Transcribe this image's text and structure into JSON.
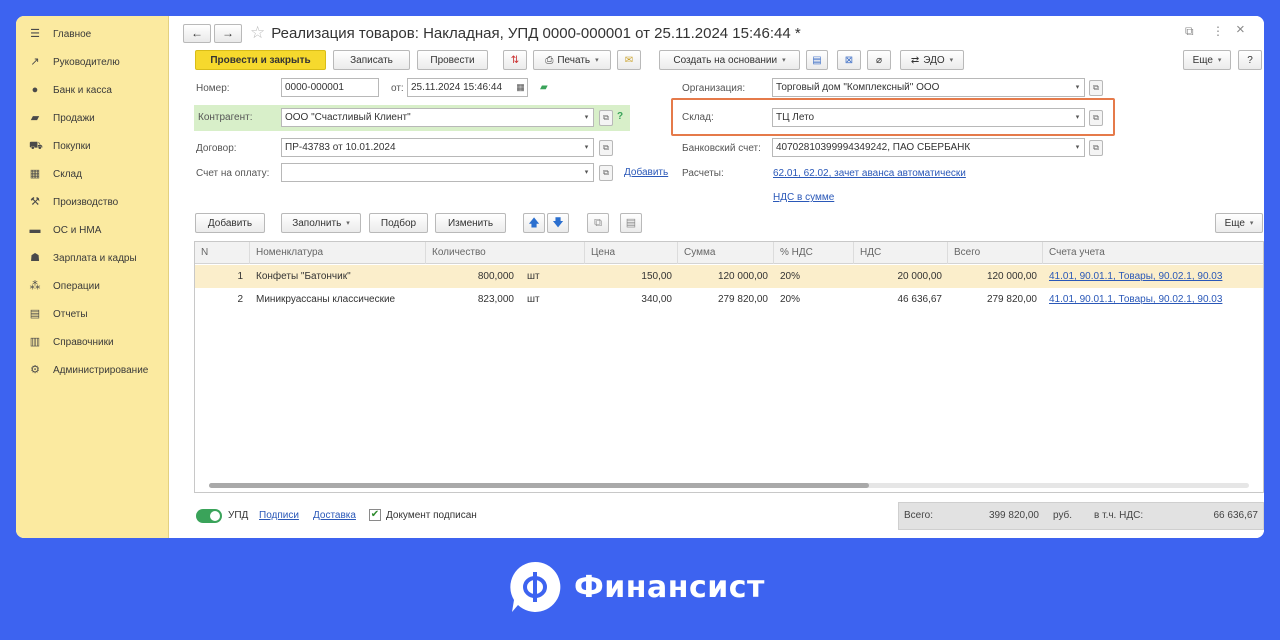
{
  "sidebar": {
    "items": [
      {
        "label": "Главное",
        "icon": "menu-icon"
      },
      {
        "label": "Руководителю",
        "icon": "chart-trend-icon"
      },
      {
        "label": "Банк и касса",
        "icon": "coins-icon"
      },
      {
        "label": "Продажи",
        "icon": "sales-icon"
      },
      {
        "label": "Покупки",
        "icon": "cart-icon"
      },
      {
        "label": "Склад",
        "icon": "warehouse-icon"
      },
      {
        "label": "Производство",
        "icon": "factory-icon"
      },
      {
        "label": "ОС и НМА",
        "icon": "truck-icon"
      },
      {
        "label": "Зарплата и кадры",
        "icon": "people-icon"
      },
      {
        "label": "Операции",
        "icon": "operations-icon"
      },
      {
        "label": "Отчеты",
        "icon": "report-icon"
      },
      {
        "label": "Справочники",
        "icon": "book-icon"
      },
      {
        "label": "Администрирование",
        "icon": "gear-icon"
      }
    ]
  },
  "header": {
    "back": "←",
    "forward": "→",
    "star": "☆",
    "title": "Реализация товаров: Накладная, УПД 0000-000001 от 25.11.2024 15:46:44 *",
    "link_icon": "🔗",
    "more": "⋮",
    "close": "×"
  },
  "toolbar": {
    "post_close": "Провести и закрыть",
    "save": "Записать",
    "post": "Провести",
    "print": "Печать",
    "create_based": "Создать на основании",
    "edo": "ЭДО",
    "more": "Еще",
    "help": "?"
  },
  "form": {
    "number_label": "Номер:",
    "number_value": "0000-000001",
    "date_label": "от:",
    "date_value": "25.11.2024 15:46:44",
    "counterparty_label": "Контрагент:",
    "counterparty_value": "ООО \"Счастливый Клиент\"",
    "counterparty_help": "?",
    "contract_label": "Договор:",
    "contract_value": "ПР-43783 от 10.01.2024",
    "invoice_label": "Счет на оплату:",
    "invoice_value": "",
    "invoice_add": "Добавить",
    "org_label": "Организация:",
    "org_value": "Торговый дом \"Комплексный\" ООО",
    "warehouse_label": "Склад:",
    "warehouse_value": "ТЦ Лето",
    "bank_label": "Банковский счет:",
    "bank_value": "40702810399994349242, ПАО СБЕРБАНК",
    "settlements_label": "Расчеты:",
    "settlements_link": "62.01, 62.02, зачет аванса автоматически",
    "vat_link": "НДС в сумме"
  },
  "table_toolbar": {
    "add": "Добавить",
    "fill": "Заполнить",
    "pick": "Подбор",
    "change": "Изменить",
    "up": "🡅",
    "down": "🡇",
    "more": "Еще"
  },
  "table": {
    "columns": [
      "N",
      "Номенклатура",
      "Количество",
      "Цена",
      "Сумма",
      "% НДС",
      "НДС",
      "Всего",
      "Счета учета"
    ],
    "rows": [
      {
        "n": "1",
        "name": "Конфеты \"Батончик\"",
        "qty": "800,000",
        "unit": "шт",
        "price": "150,00",
        "sum": "120 000,00",
        "vat_rate": "20%",
        "vat": "20 000,00",
        "total": "120 000,00",
        "accounts": "41.01, 90.01.1, Товары, 90.02.1, 90.03"
      },
      {
        "n": "2",
        "name": "Миникруассаны классические",
        "qty": "823,000",
        "unit": "шт",
        "price": "340,00",
        "sum": "279 820,00",
        "vat_rate": "20%",
        "vat": "46 636,67",
        "total": "279 820,00",
        "accounts": "41.01, 90.01.1, Товары, 90.02.1, 90.03"
      }
    ]
  },
  "footer": {
    "upd_label": "УПД",
    "signatures": "Подписи",
    "delivery": "Доставка",
    "signed_label": "Документ подписан",
    "total_label": "Всего:",
    "total_value": "399 820,00",
    "currency": "руб.",
    "vat_label": "в т.ч. НДС:",
    "vat_value": "66 636,67"
  },
  "brand": {
    "name": "Финансист",
    "color": "#3d63f0"
  }
}
